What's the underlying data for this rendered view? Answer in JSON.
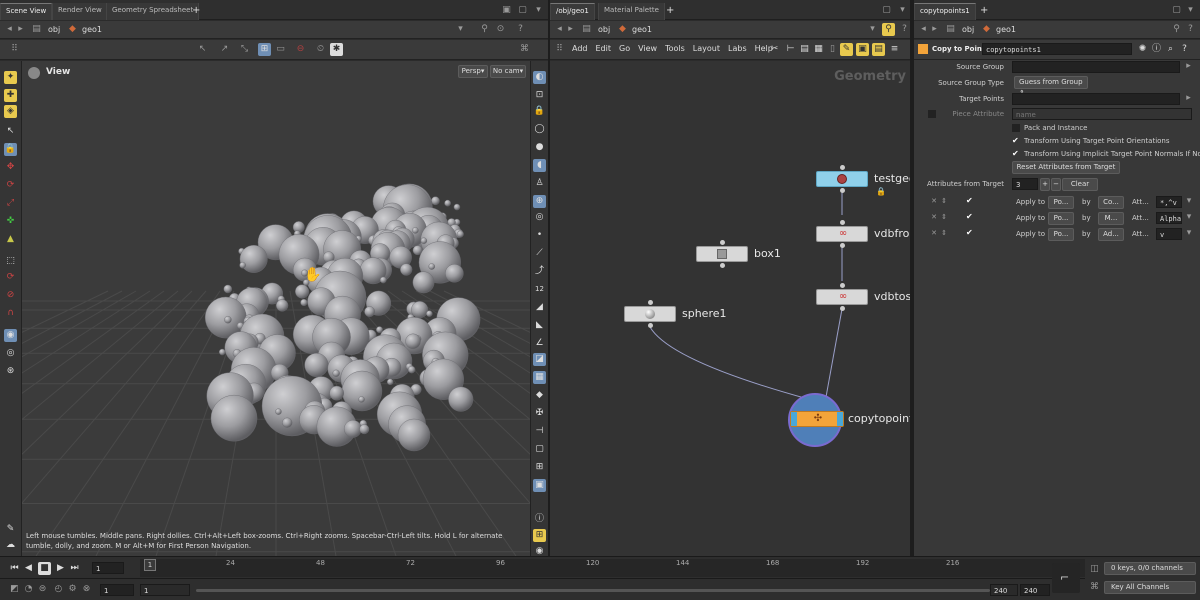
{
  "left_panel": {
    "tabs": [
      "Scene View",
      "Render View",
      "Geometry Spreadsheet",
      "+"
    ],
    "path": {
      "root": "obj",
      "node": "geo1"
    },
    "viewport": {
      "title": "View",
      "camera_menu": "Persp",
      "cam_menu": "No cam",
      "help_text": "Left mouse tumbles. Middle pans. Right dollies. Ctrl+Alt+Left box-zooms. Ctrl+Right zooms. Spacebar-Ctrl-Left tilts. Hold L for alternate tumble, dolly, and zoom. M or Alt+M for First Person Navigation."
    }
  },
  "network_panel": {
    "tabs": [
      "/obj/geo1",
      "Material Palette",
      "+"
    ],
    "path": {
      "root": "obj",
      "node": "geo1"
    },
    "menu": [
      "Add",
      "Edit",
      "Go",
      "View",
      "Tools",
      "Layout",
      "Labs",
      "Help"
    ],
    "context_label": "Geometry",
    "nodes": [
      {
        "name": "testgeo",
        "type": "test"
      },
      {
        "name": "vdbfrom",
        "type": "vdb"
      },
      {
        "name": "box1",
        "type": "box"
      },
      {
        "name": "vdbtosp",
        "type": "vdb"
      },
      {
        "name": "sphere1",
        "type": "sphere"
      },
      {
        "name": "copytopoints",
        "type": "copy"
      }
    ]
  },
  "params_panel": {
    "tabs": [
      "copytopoints1",
      "+"
    ],
    "path": {
      "root": "obj",
      "node": "geo1"
    },
    "op_type": "Copy to Points",
    "op_name": "copytopoints1",
    "fields": {
      "source_group": {
        "label": "Source Group",
        "value": ""
      },
      "source_group_type": {
        "label": "Source Group Type",
        "value": "Guess from Group"
      },
      "target_points": {
        "label": "Target Points",
        "value": ""
      },
      "piece_attribute": {
        "label": "Piece Attribute",
        "value": "name"
      }
    },
    "checks": {
      "pack_instance": "Pack and Instance",
      "orient": "Transform Using Target Point Orientations",
      "implicit": "Transform Using Implicit Target Point Normals If No P..."
    },
    "reset_button": "Reset Attributes from Target",
    "attrs_from_target": {
      "label": "Attributes from Target",
      "value": "3",
      "plus": "+",
      "minus": "−",
      "clear": "Clear"
    },
    "attr_rows": [
      {
        "apply": "Apply to",
        "a": "Po...",
        "by": "by",
        "b": "Co...",
        "att": "Att...",
        "val": "*,^v"
      },
      {
        "apply": "Apply to",
        "a": "Po...",
        "by": "by",
        "b": "M...",
        "att": "Att...",
        "val": "Alpha"
      },
      {
        "apply": "Apply to",
        "a": "Po...",
        "by": "by",
        "b": "Ad...",
        "att": "Att...",
        "val": "v"
      }
    ]
  },
  "timeline": {
    "frame": "1",
    "start": "1",
    "start2": "1",
    "end": "240",
    "end2": "240",
    "ticks": [
      "24",
      "48",
      "72",
      "96",
      "120",
      "144",
      "168",
      "192",
      "216"
    ],
    "keys_info": "0 keys, 0/0 channels",
    "key_all": "Key All Channels"
  }
}
